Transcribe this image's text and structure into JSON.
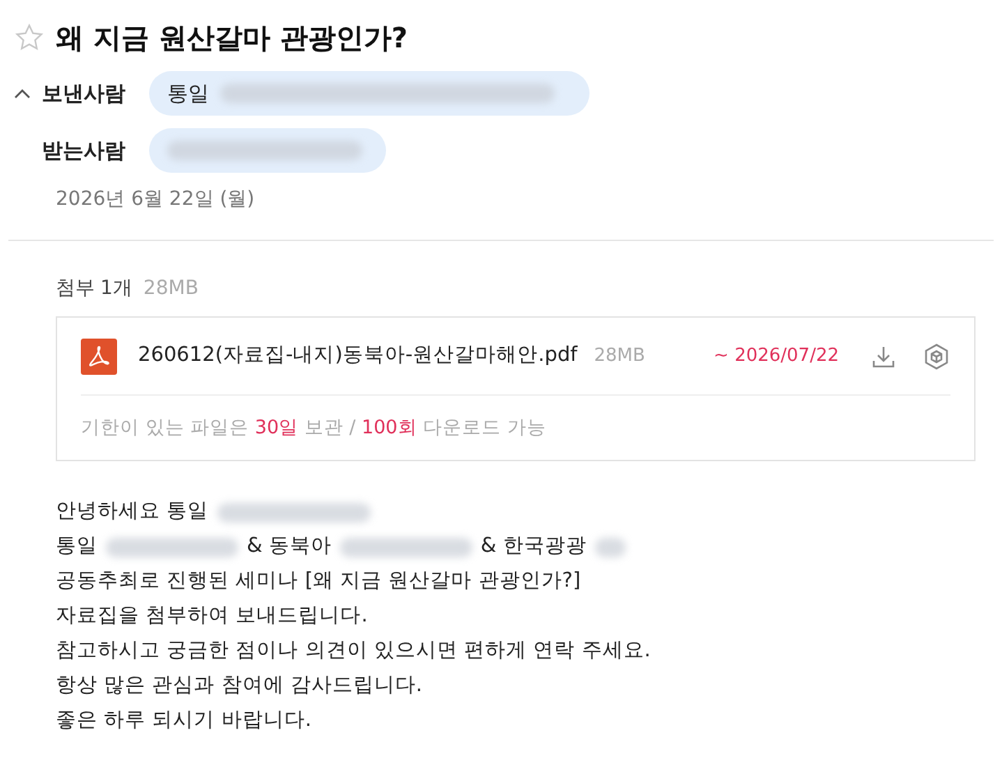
{
  "title": "왜 지금 원산갈마 관광인가?",
  "starred": false,
  "header": {
    "expanded": true,
    "sender": {
      "label": "보낸사람",
      "name": "통일"
    },
    "recipient": {
      "label": "받는사람"
    },
    "date": "2026년 6월 22일 (월)"
  },
  "attachments": {
    "label": "첨부",
    "count": "1개",
    "total_size": "28MB",
    "files": [
      {
        "name": "260612(자료집-내지)동북아-원산갈마해안.pdf",
        "size": "28MB",
        "expires": "~ 2026/07/22"
      }
    ],
    "note": [
      {
        "text": "기한이 있는 파일은 ",
        "highlight": false
      },
      {
        "text": "30일",
        "highlight": true
      },
      {
        "text": " 보관 / ",
        "highlight": false
      },
      {
        "text": "100회",
        "highlight": true
      },
      {
        "text": " 다운로드 가능",
        "highlight": false
      }
    ]
  },
  "body": [
    [
      {
        "kind": "text",
        "text": "안녕하세요 통일"
      },
      {
        "kind": "redacted"
      }
    ],
    [
      {
        "kind": "text",
        "text": "통일"
      },
      {
        "kind": "redacted"
      },
      {
        "kind": "text",
        "text": "& 동북아"
      },
      {
        "kind": "redacted"
      },
      {
        "kind": "text",
        "text": "& 한국광광"
      },
      {
        "kind": "redacted"
      }
    ],
    [
      {
        "kind": "text",
        "text": "공동추최로 진행된 세미나 [왜 지금 원산갈마 관광인가?]"
      }
    ],
    [
      {
        "kind": "text",
        "text": "자료집을 첨부하여 보내드립니다."
      }
    ],
    [
      {
        "kind": "text",
        "text": "참고하시고 궁금한 점이나 의견이 있으시면 편하게 연락 주세요."
      }
    ],
    [
      {
        "kind": "text",
        "text": "항상 많은 관심과 참여에 감사드립니다."
      }
    ],
    [
      {
        "kind": "text",
        "text": "좋은 하루 되시기 바랍니다."
      }
    ]
  ]
}
